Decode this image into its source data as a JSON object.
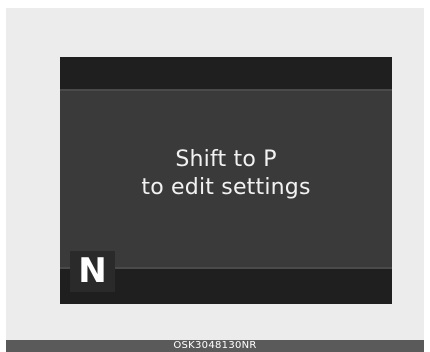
{
  "display": {
    "message_line1": "Shift to P",
    "message_line2": "to edit settings",
    "gear_indicator": "N"
  },
  "caption": {
    "code": "OSK3048130NR"
  }
}
